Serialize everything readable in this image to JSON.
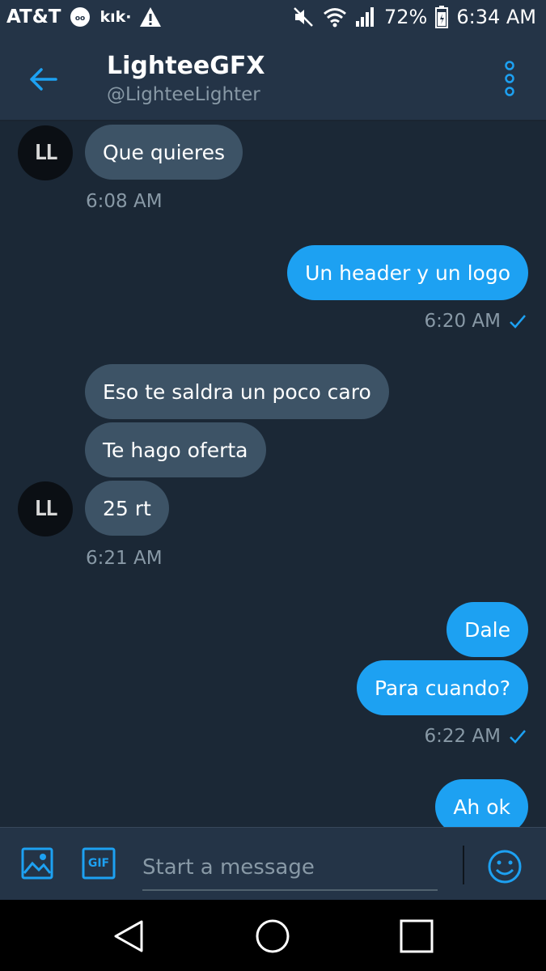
{
  "status_bar": {
    "carrier": "AT&T",
    "kik_label": "kık·",
    "battery": "72%",
    "time": "6:34 AM"
  },
  "header": {
    "title": "LighteeGFX",
    "handle": "@LighteeLighter"
  },
  "messages": [
    {
      "side": "in",
      "text": "Que quieres"
    },
    {
      "side": "time",
      "text": "6:08 AM"
    },
    {
      "side": "out",
      "text": "Un header y un logo"
    },
    {
      "side": "time",
      "text": "6:20 AM"
    },
    {
      "side": "in",
      "text": "Eso te saldra un poco caro"
    },
    {
      "side": "in",
      "text": "Te hago oferta"
    },
    {
      "side": "in",
      "text": "25 rt"
    },
    {
      "side": "time",
      "text": "6:21 AM"
    },
    {
      "side": "out",
      "text": "Dale"
    },
    {
      "side": "out",
      "text": "Para cuando?"
    },
    {
      "side": "time",
      "text": "6:22 AM"
    },
    {
      "side": "out",
      "text": "Ah ok"
    }
  ],
  "compose": {
    "placeholder": "Start a message",
    "gif_label": "GIF"
  },
  "colors": {
    "background": "#1b2836",
    "header": "#243447",
    "incoming_bubble": "#3d5366",
    "outgoing_bubble": "#1da1f2",
    "accent": "#1da1f2",
    "muted_text": "#8899a6"
  },
  "icons": {
    "back": "arrow-left-icon",
    "more": "more-vertical-icon",
    "image": "image-icon",
    "gif": "gif-icon",
    "emoji": "emoji-icon",
    "read_check": "check-icon"
  }
}
